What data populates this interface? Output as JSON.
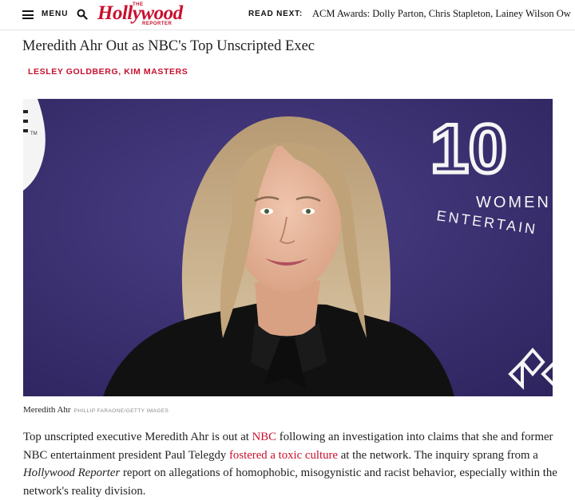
{
  "header": {
    "menu_label": "MENU",
    "logo_text": "Hollywood",
    "logo_the": "THE",
    "logo_reporter": "REPORTER",
    "read_next_label": "READ NEXT:",
    "read_next_text": "ACM Awards: Dolly Parton, Chris Stapleton, Lainey Wilson Ow"
  },
  "article": {
    "headline": "Meredith Ahr Out as NBC's Top Unscripted Exec",
    "authors": [
      {
        "name": "LESLEY GOLDBERG"
      },
      {
        "name": "KIM MASTERS"
      }
    ],
    "author_separator": ", ",
    "photo": {
      "backdrop_number": "10",
      "backdrop_line1": "WOMEN",
      "backdrop_line2": "ENTERTAIN",
      "backdrop_tm": "TM",
      "caption": "Meredith Ahr",
      "credit": "PHILLIP FARAONE/GETTY IMAGES"
    },
    "body": {
      "s1": "Top unscripted executive Meredith Ahr is out at ",
      "link1": "NBC",
      "s2": " following an investigation into claims that she and former NBC entertainment president Paul Telegdy ",
      "link2": "fostered a toxic culture",
      "s3": " at the network. The inquiry sprang from a ",
      "em1": "Hollywood Reporter",
      "s4": " report on allegations of homophobic, misogynistic and racist behavior, especially within the network's reality division."
    }
  },
  "colors": {
    "brand_red": "#c8102e",
    "backdrop_purple": "#3a2e70"
  }
}
